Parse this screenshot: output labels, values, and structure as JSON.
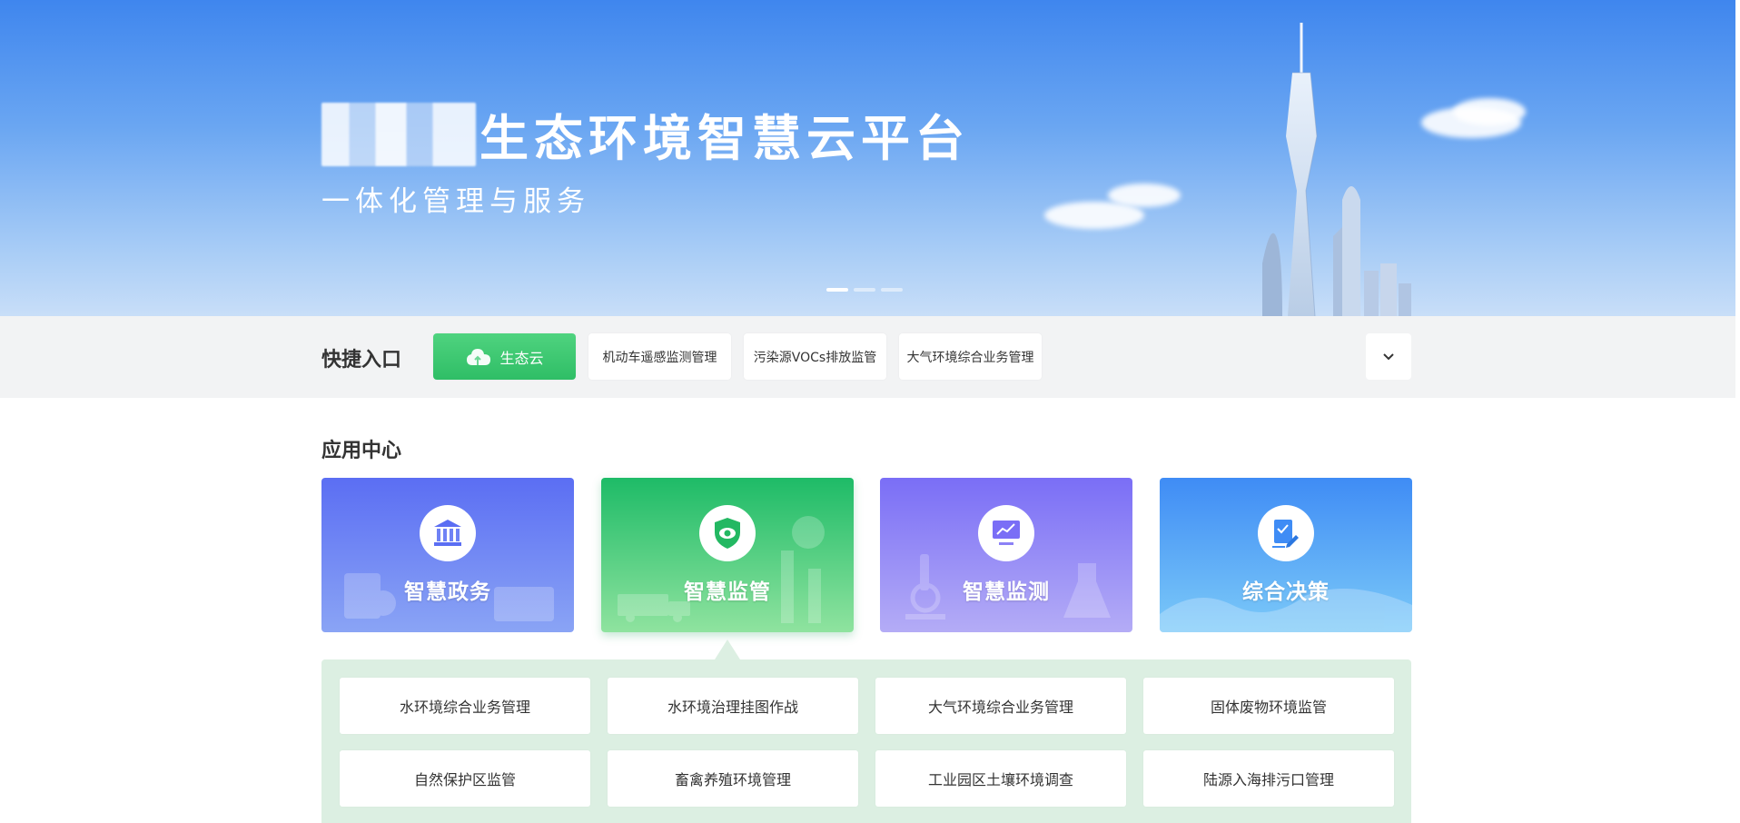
{
  "banner": {
    "title": "生态环境智慧云平台",
    "subtitle": "一体化管理与服务",
    "slides": 3,
    "active_slide": 0
  },
  "quick_entry": {
    "title": "快捷入口",
    "items": [
      {
        "label": "生态云",
        "icon": "cloud-icon",
        "primary": true
      },
      {
        "label": "机动车遥感监测管理"
      },
      {
        "label": "污染源VOCs排放监管"
      },
      {
        "label": "大气环境综合业务管理"
      }
    ],
    "expand_icon": "chevron-down-icon"
  },
  "app_center": {
    "title": "应用中心",
    "cards": [
      {
        "label": "智慧政务",
        "icon": "bank-icon"
      },
      {
        "label": "智慧监管",
        "icon": "shield-eye-icon"
      },
      {
        "label": "智慧监测",
        "icon": "monitor-chart-icon"
      },
      {
        "label": "综合决策",
        "icon": "document-check-icon"
      }
    ],
    "active_card": 1,
    "sub_items": [
      "水环境综合业务管理",
      "水环境治理挂图作战",
      "大气环境综合业务管理",
      "固体废物环境监管",
      "自然保护区监管",
      "畜禽养殖环境管理",
      "工业园区土壤环境调查",
      "陆源入海排污口管理"
    ]
  },
  "colors": {
    "primary_green": "#2fbe66",
    "panel_green": "#dcefe2",
    "banner_blue": "#3f86ee"
  }
}
